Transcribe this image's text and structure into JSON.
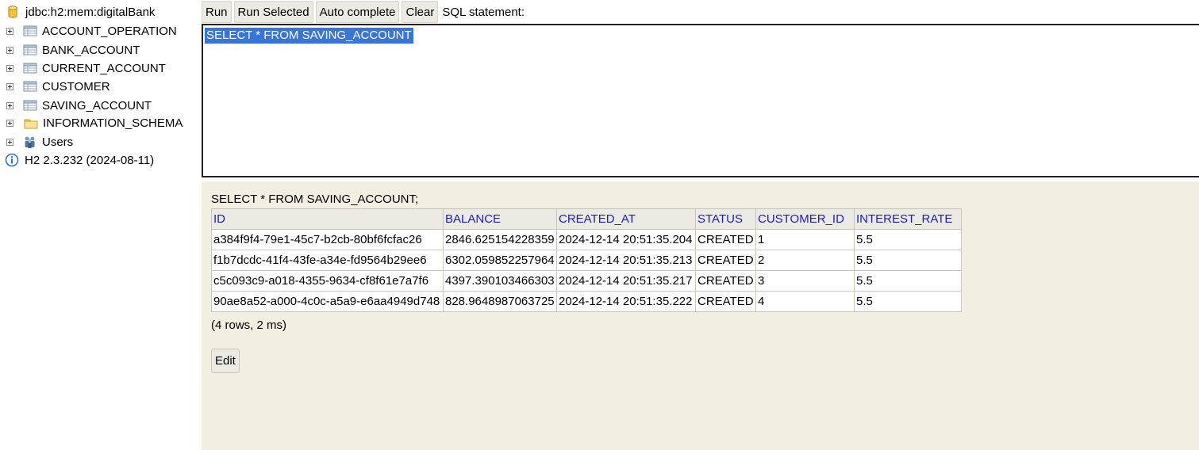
{
  "tree": {
    "connection": "jdbc:h2:mem:digitalBank",
    "tables": [
      {
        "label": "ACCOUNT_OPERATION",
        "icon": "table-icon"
      },
      {
        "label": "BANK_ACCOUNT",
        "icon": "table-icon"
      },
      {
        "label": "CURRENT_ACCOUNT",
        "icon": "table-icon"
      },
      {
        "label": "CUSTOMER",
        "icon": "table-icon"
      },
      {
        "label": "SAVING_ACCOUNT",
        "icon": "table-icon"
      }
    ],
    "schema": {
      "label": "INFORMATION_SCHEMA",
      "icon": "folder-icon"
    },
    "users": {
      "label": "Users",
      "icon": "users-icon"
    },
    "version": {
      "label": "H2 2.3.232 (2024-08-11)",
      "icon": "info-icon"
    }
  },
  "toolbar": {
    "run": "Run",
    "run_selected": "Run Selected",
    "auto_complete": "Auto complete",
    "clear": "Clear",
    "sql_label": "SQL statement:"
  },
  "editor": {
    "value": "SELECT * FROM SAVING_ACCOUNT"
  },
  "result": {
    "query": "SELECT * FROM SAVING_ACCOUNT;",
    "columns": [
      "ID",
      "BALANCE",
      "CREATED_AT",
      "STATUS",
      "CUSTOMER_ID",
      "INTEREST_RATE"
    ],
    "rows": [
      [
        "a384f9f4-79e1-45c7-b2cb-80bf6fcfac26",
        "2846.625154228359",
        "2024-12-14 20:51:35.204",
        "CREATED",
        "1",
        "5.5"
      ],
      [
        "f1b7dcdc-41f4-43fe-a34e-fd9564b29ee6",
        "6302.059852257964",
        "2024-12-14 20:51:35.213",
        "CREATED",
        "2",
        "5.5"
      ],
      [
        "c5c093c9-a018-4355-9634-cf8f61e7a7f6",
        "4397.390103466303",
        "2024-12-14 20:51:35.217",
        "CREATED",
        "3",
        "5.5"
      ],
      [
        "90ae8a52-a000-4c0c-a5a9-e6aa4949d748",
        "828.9648987063725",
        "2024-12-14 20:51:35.222",
        "CREATED",
        "4",
        "5.5"
      ]
    ],
    "row_count": "(4 rows, 2 ms)",
    "edit_label": "Edit"
  },
  "colors": {
    "result_background": "#f1efe1",
    "header_link": "#1a1ad2",
    "selection": "#3875d7"
  }
}
